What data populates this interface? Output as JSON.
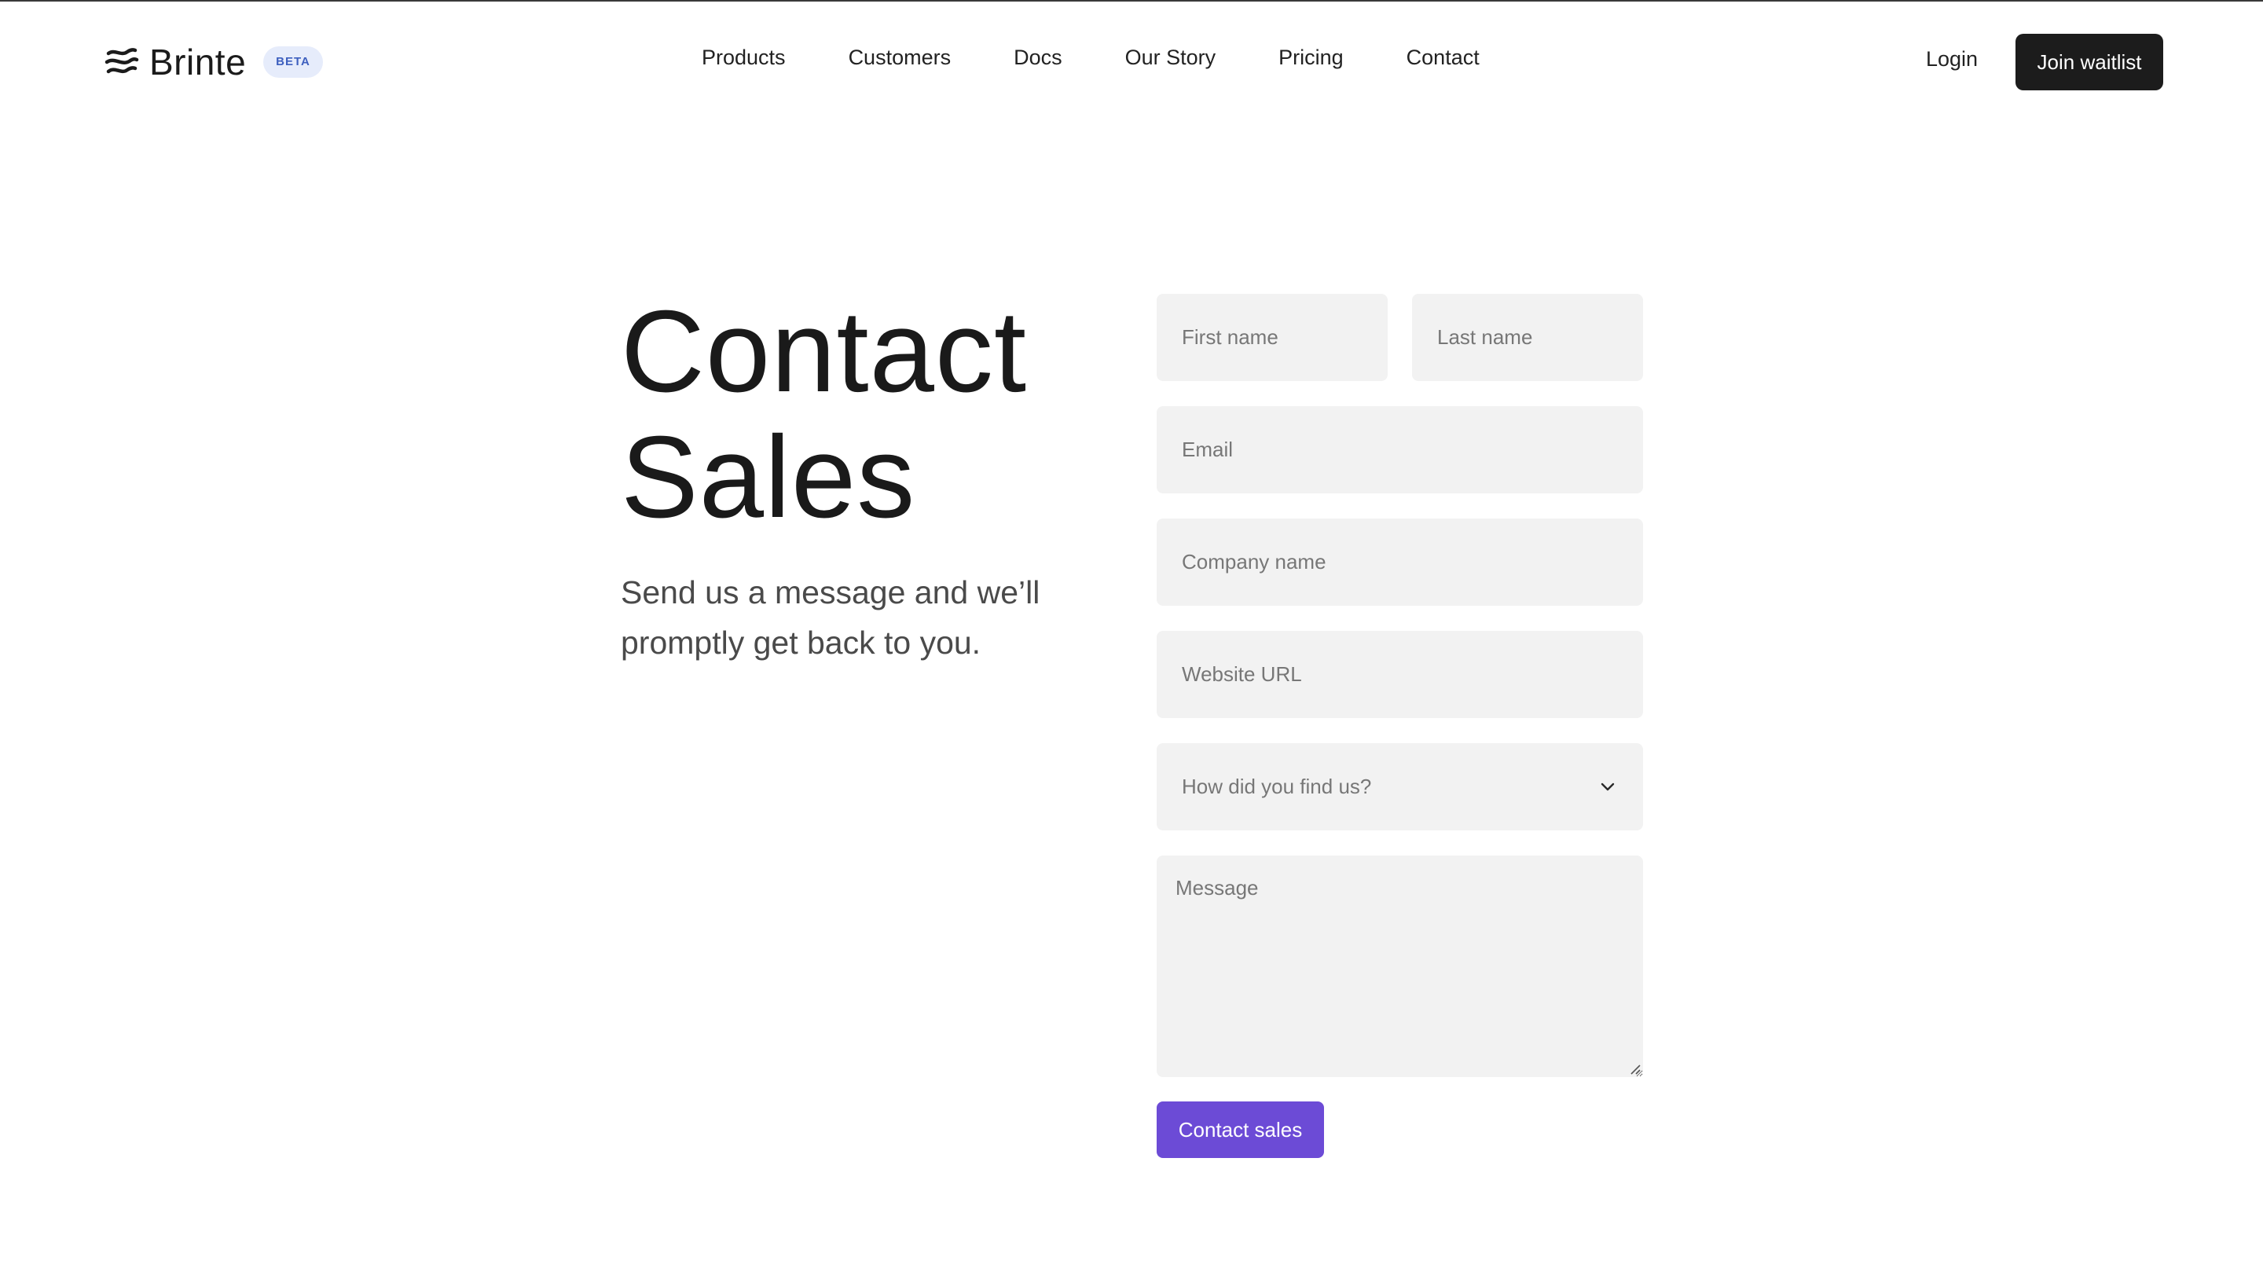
{
  "brand": {
    "name": "Brinte",
    "badge": "BETA"
  },
  "nav": {
    "links": [
      {
        "label": "Products"
      },
      {
        "label": "Customers"
      },
      {
        "label": "Docs"
      },
      {
        "label": "Our Story"
      },
      {
        "label": "Pricing"
      },
      {
        "label": "Contact"
      }
    ],
    "login_label": "Login",
    "cta_label": "Join waitlist"
  },
  "hero": {
    "title_line1": "Contact",
    "title_line2": "Sales",
    "subtitle": "Send us a message and we’ll promptly get back to you."
  },
  "form": {
    "first_name_placeholder": "First name",
    "last_name_placeholder": "Last name",
    "email_placeholder": "Email",
    "company_placeholder": "Company name",
    "website_placeholder": "Website URL",
    "source_select_value": "How did you find us?",
    "message_placeholder": "Message",
    "submit_label": "Contact sales"
  },
  "colors": {
    "accent": "#6c4bd6",
    "dark_button": "#1c1c1c",
    "field_bg": "#f2f2f2",
    "badge_bg": "#e6ecfb",
    "badge_text": "#3d5fbf"
  }
}
